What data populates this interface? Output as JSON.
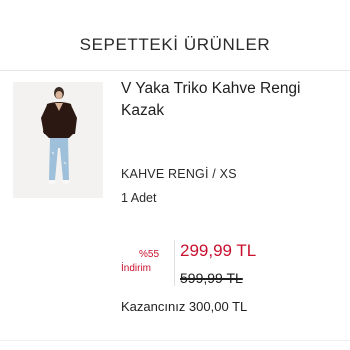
{
  "section": {
    "title": "SEPETTEKİ ÜRÜNLER"
  },
  "product": {
    "name": "V Yaka Triko Kahve Rengi Kazak",
    "variant": "KAHVE RENGİ / XS",
    "quantity": "1 Adet",
    "image_icon": "product-photo-icon"
  },
  "pricing": {
    "discount_percent": "%55",
    "discount_label": "İndirim",
    "current_price": "299,99 TL",
    "original_price": "599,99 TL",
    "savings": "Kazancınız 300,00 TL"
  },
  "colors": {
    "accent_red": "#c8102e",
    "text": "#1f1f1f",
    "divider": "#e6e6e6"
  }
}
